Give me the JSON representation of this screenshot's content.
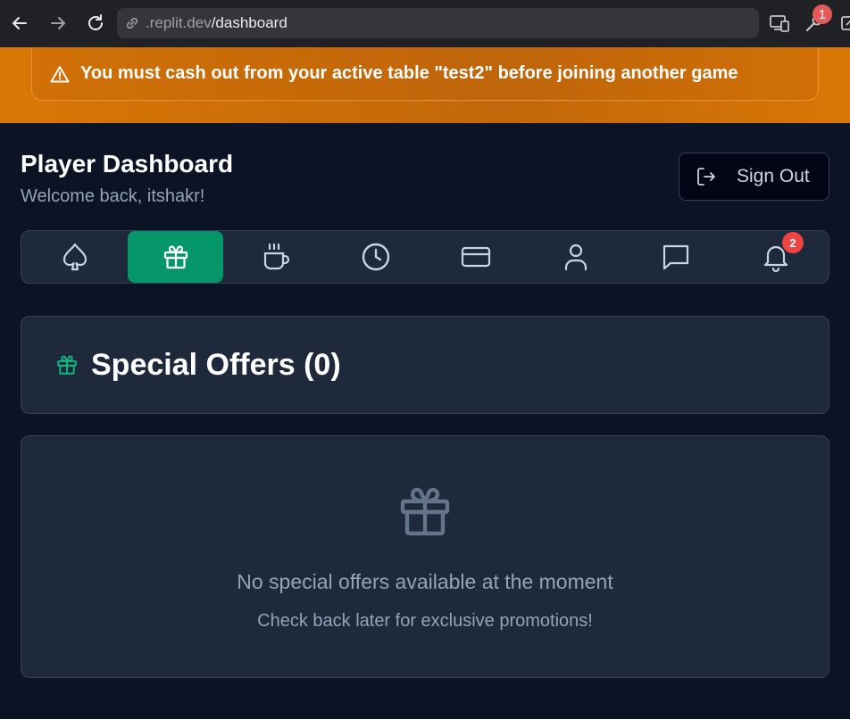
{
  "browser": {
    "url_host": ".replit.dev",
    "url_path": "/dashboard",
    "extension_badge": "1"
  },
  "banner": {
    "icon": "warning-icon",
    "text": "You must cash out from your active table \"test2\" before joining another game"
  },
  "header": {
    "title": "Player Dashboard",
    "welcome": "Welcome back, itshakr!",
    "signout_label": "Sign Out"
  },
  "tabs": [
    {
      "icon": "spade-icon",
      "active": false
    },
    {
      "icon": "gift-icon",
      "active": true
    },
    {
      "icon": "coffee-icon",
      "active": false
    },
    {
      "icon": "clock-icon",
      "active": false
    },
    {
      "icon": "credit-card-icon",
      "active": false
    },
    {
      "icon": "user-icon",
      "active": false
    },
    {
      "icon": "chat-icon",
      "active": false
    },
    {
      "icon": "bell-icon",
      "active": false
    }
  ],
  "notifications_badge": "2",
  "offers": {
    "title": "Special Offers (0)",
    "empty_message": "No special offers available at the moment",
    "empty_sub": "Check back later for exclusive promotions!"
  },
  "colors": {
    "accent": "#059669",
    "banner": "#d97706",
    "badge": "#ef4444",
    "background": "#0c1325",
    "card": "#1e293b"
  }
}
